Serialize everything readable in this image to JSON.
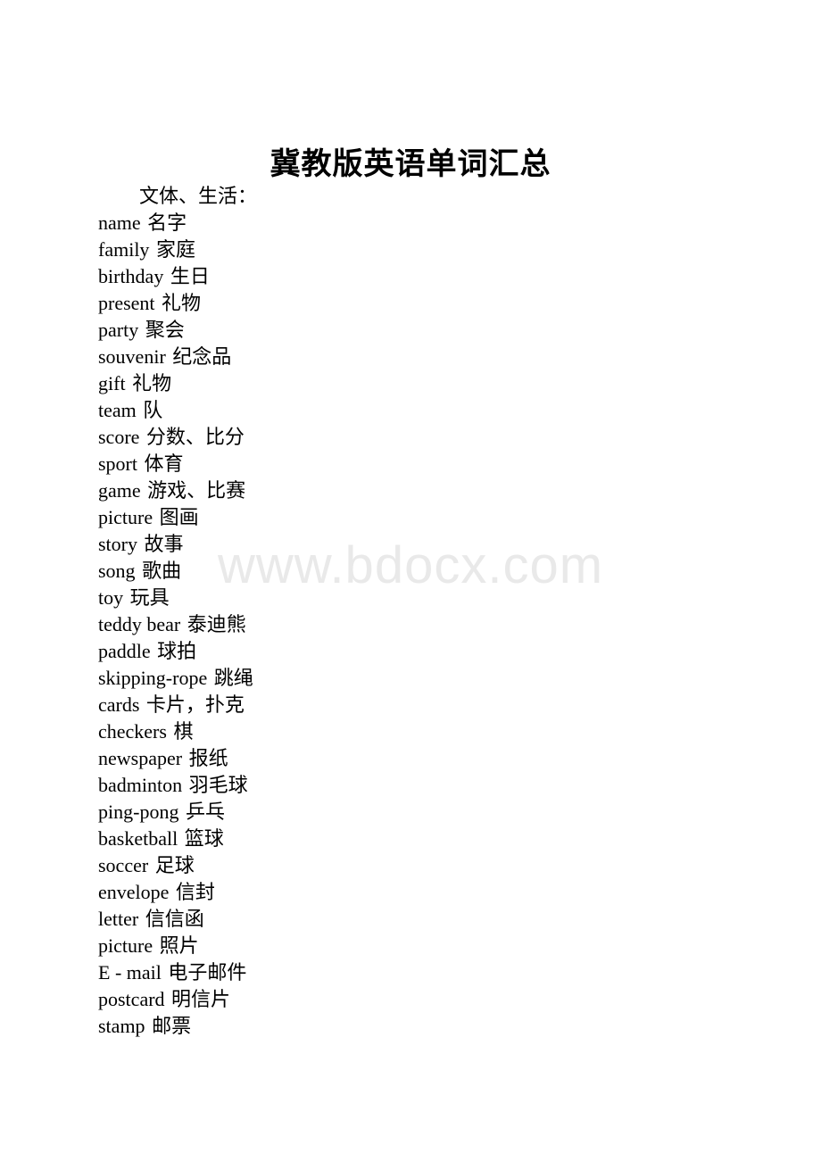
{
  "document": {
    "title": "冀教版英语单词汇总",
    "watermark": "www.bdocx.com",
    "section_heading": "文体、生活：",
    "words": [
      {
        "en": "name",
        "cn": "名字"
      },
      {
        "en": "family",
        "cn": "家庭"
      },
      {
        "en": "birthday",
        "cn": "生日"
      },
      {
        "en": "present",
        "cn": "礼物"
      },
      {
        "en": "party",
        "cn": "聚会"
      },
      {
        "en": "souvenir",
        "cn": "纪念品"
      },
      {
        "en": "gift",
        "cn": "礼物"
      },
      {
        "en": "team",
        "cn": "队"
      },
      {
        "en": "score",
        "cn": "分数、比分"
      },
      {
        "en": "sport",
        "cn": "体育"
      },
      {
        "en": "game",
        "cn": "游戏、比赛"
      },
      {
        "en": "picture",
        "cn": "图画"
      },
      {
        "en": "story",
        "cn": "故事"
      },
      {
        "en": "song",
        "cn": "歌曲"
      },
      {
        "en": "toy",
        "cn": "玩具"
      },
      {
        "en": "teddy bear",
        "cn": "泰迪熊"
      },
      {
        "en": "paddle",
        "cn": "球拍"
      },
      {
        "en": "skipping-rope",
        "cn": "跳绳"
      },
      {
        "en": "cards",
        "cn": "卡片，扑克"
      },
      {
        "en": "checkers",
        "cn": "棋"
      },
      {
        "en": "newspaper",
        "cn": "报纸"
      },
      {
        "en": "badminton",
        "cn": "羽毛球"
      },
      {
        "en": "ping-pong",
        "cn": "乒乓"
      },
      {
        "en": "basketball",
        "cn": "篮球"
      },
      {
        "en": "soccer",
        "cn": "足球"
      },
      {
        "en": "envelope",
        "cn": "信封"
      },
      {
        "en": "letter",
        "cn": "信信函"
      },
      {
        "en": "picture",
        "cn": "照片"
      },
      {
        "en": "E - mail",
        "cn": "电子邮件"
      },
      {
        "en": "postcard",
        "cn": "明信片"
      },
      {
        "en": "stamp",
        "cn": "邮票"
      }
    ]
  },
  "colors": {
    "page_background": "#ffffff",
    "text": "#000000",
    "watermark": "#e9e9e9"
  }
}
